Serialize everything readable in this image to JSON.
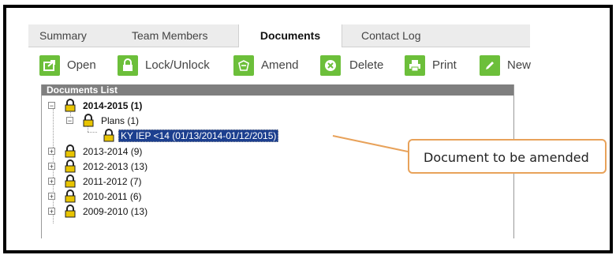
{
  "tabs": [
    {
      "label": "Summary",
      "active": false
    },
    {
      "label": "Team Members",
      "active": false
    },
    {
      "label": "Documents",
      "active": true
    },
    {
      "label": "Contact Log",
      "active": false
    }
  ],
  "toolbar": {
    "open": "Open",
    "lock_unlock": "Lock/Unlock",
    "amend": "Amend",
    "delete": "Delete",
    "print": "Print",
    "new": "New"
  },
  "documents_list": {
    "header": "Documents List",
    "nodes": [
      {
        "label": "2014-2015 (1)",
        "expanded": true
      },
      {
        "label": "Plans (1)",
        "expanded": true
      },
      {
        "label": "KY IEP <14 (01/13/2014-01/12/2015)",
        "selected": true
      },
      {
        "label": "2013-2014 (9)",
        "expanded": false
      },
      {
        "label": "2012-2013 (13)",
        "expanded": false
      },
      {
        "label": "2011-2012 (7)",
        "expanded": false
      },
      {
        "label": "2010-2011 (6)",
        "expanded": false
      },
      {
        "label": "2009-2010 (13)",
        "expanded": false
      }
    ]
  },
  "callout": {
    "text": "Document to be amended"
  },
  "colors": {
    "toolbar_icon_bg": "#6cbf3a",
    "selection_bg": "#1c3f8f",
    "callout_border": "#e8a25a",
    "list_header_bg": "#7f7f7f",
    "lock_icon": "#d9b400"
  }
}
